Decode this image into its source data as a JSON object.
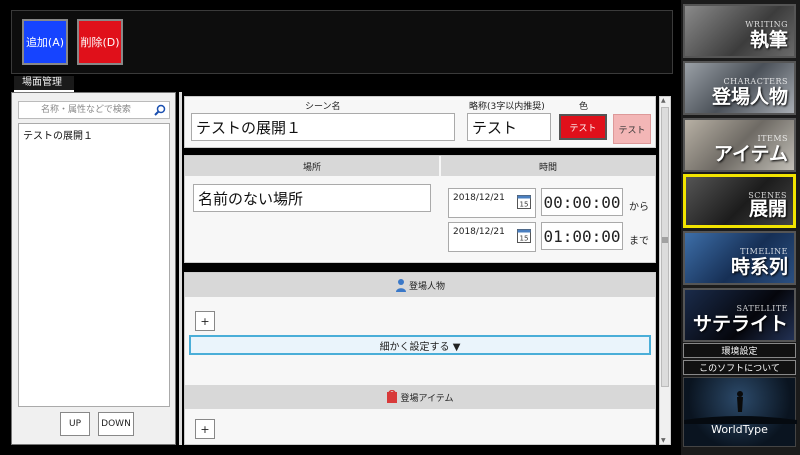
{
  "toolbar": {
    "add_label": "追加(A)",
    "delete_label": "削除(D)"
  },
  "tab": {
    "label": "場面管理"
  },
  "left": {
    "search_placeholder": "名称・属性などで検索",
    "items": [
      "テストの展開１"
    ],
    "up_label": "UP",
    "down_label": "DOWN"
  },
  "scene": {
    "name_label": "シーン名",
    "name_value": "テストの展開１",
    "short_label": "略称(3字以内推奨)",
    "short_value": "テスト",
    "color_label": "色",
    "color_btn1": "テスト",
    "color_btn2": "テスト",
    "accent_color": "#e0101a"
  },
  "place_time": {
    "place_header": "場所",
    "time_header": "時間",
    "place_value": "名前のない場所",
    "start_date": "2018/12/21",
    "start_time": "00:00:00",
    "start_suffix": "から",
    "end_date": "2018/12/21",
    "end_time": "01:00:00",
    "end_suffix": "まで"
  },
  "characters": {
    "header": "登場人物",
    "add": "+",
    "detail": "細かく設定する ▼"
  },
  "items": {
    "header": "登場アイテム",
    "add": "+"
  },
  "sidebar": {
    "tiles": [
      {
        "sub": "WRITING",
        "main": "執筆"
      },
      {
        "sub": "CHARACTERS",
        "main": "登場人物"
      },
      {
        "sub": "ITEMS",
        "main": "アイテム"
      },
      {
        "sub": "SCENES",
        "main": "展開"
      },
      {
        "sub": "TIMELINE",
        "main": "時系列"
      },
      {
        "sub": "SATELLITE",
        "main": "サテライト"
      }
    ],
    "settings": "環境設定",
    "about": "このソフトについて",
    "worldtype": "WorldType",
    "selected_border": "#f2e400"
  }
}
